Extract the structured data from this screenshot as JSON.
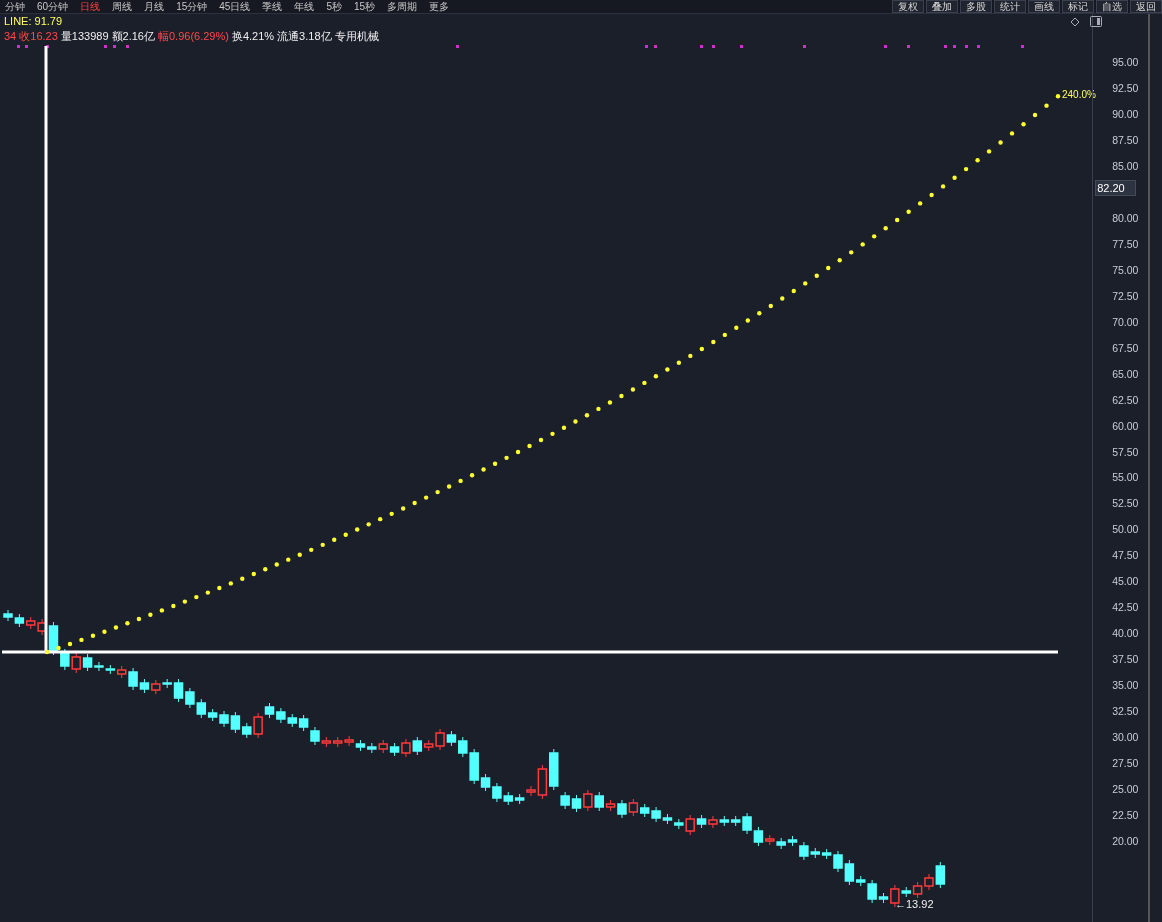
{
  "toolbar": {
    "left": [
      {
        "label": "分钟",
        "selected": false
      },
      {
        "label": "60分钟",
        "selected": false
      },
      {
        "label": "日线",
        "selected": true
      },
      {
        "label": "周线",
        "selected": false
      },
      {
        "label": "月线",
        "selected": false
      },
      {
        "label": "15分钟",
        "selected": false
      },
      {
        "label": "45日线",
        "selected": false
      },
      {
        "label": "季线",
        "selected": false
      },
      {
        "label": "年线",
        "selected": false
      },
      {
        "label": "5秒",
        "selected": false
      },
      {
        "label": "15秒",
        "selected": false
      },
      {
        "label": "多周期",
        "selected": false
      },
      {
        "label": "更多",
        "selected": false
      }
    ],
    "right": [
      "复权",
      "叠加",
      "多股",
      "统计",
      "画线",
      "标记",
      "自选",
      "返回"
    ]
  },
  "indicator": {
    "label": "LINE: 91.79"
  },
  "quote": [
    {
      "text": "34 收16.23",
      "kind": "up"
    },
    {
      "text": "量133989",
      "kind": "plain"
    },
    {
      "text": "额2.16亿",
      "kind": "plain"
    },
    {
      "text": "幅0.96(6.29%)",
      "kind": "up"
    },
    {
      "text": "换4.21%",
      "kind": "plain"
    },
    {
      "text": "流通3.18亿",
      "kind": "plain"
    },
    {
      "text": "专用机械",
      "kind": "plain"
    }
  ],
  "chart": {
    "price_ticks": [
      "95.00",
      "92.50",
      "90.00",
      "87.50",
      "85.00",
      "80.00",
      "77.50",
      "75.00",
      "72.50",
      "70.00",
      "67.50",
      "65.00",
      "62.50",
      "60.00",
      "57.50",
      "55.00",
      "52.50",
      "50.00",
      "47.50",
      "45.00",
      "42.50",
      "40.00",
      "37.50",
      "35.00",
      "32.50",
      "30.00",
      "27.50",
      "25.00",
      "22.50",
      "20.00"
    ],
    "current_price": "82.20",
    "projection_label": "240.0%",
    "low_label": "←13.92"
  }
}
